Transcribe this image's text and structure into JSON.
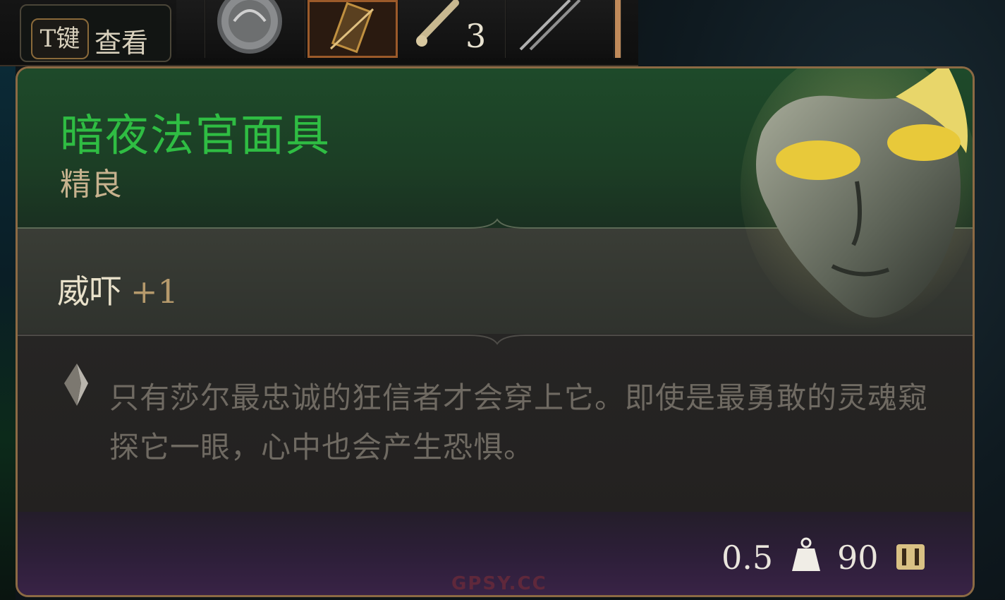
{
  "hotbar": {
    "hint_key": "T键",
    "hint_label": "查看",
    "stack_count": "3"
  },
  "item": {
    "name": "暗夜法官面具",
    "rarity": "精良",
    "stat_name": "威吓",
    "stat_value": "+1",
    "description": "只有莎尔最忠诚的狂信者才会穿上它。即使是最勇敢的灵魂窥探它一眼，心中也会产生恐惧。",
    "weight": "0.5",
    "price": "90"
  },
  "icons": {
    "weight": "weight-icon",
    "gold": "gold-coin-icon",
    "description_marker": "quote-marker-icon",
    "item_art": "mask-icon"
  },
  "colors": {
    "name_uncommon": "#2fbd43",
    "rarity": "#c7b28e",
    "border": "#8c6a44"
  },
  "watermark": "GPSY.CC"
}
